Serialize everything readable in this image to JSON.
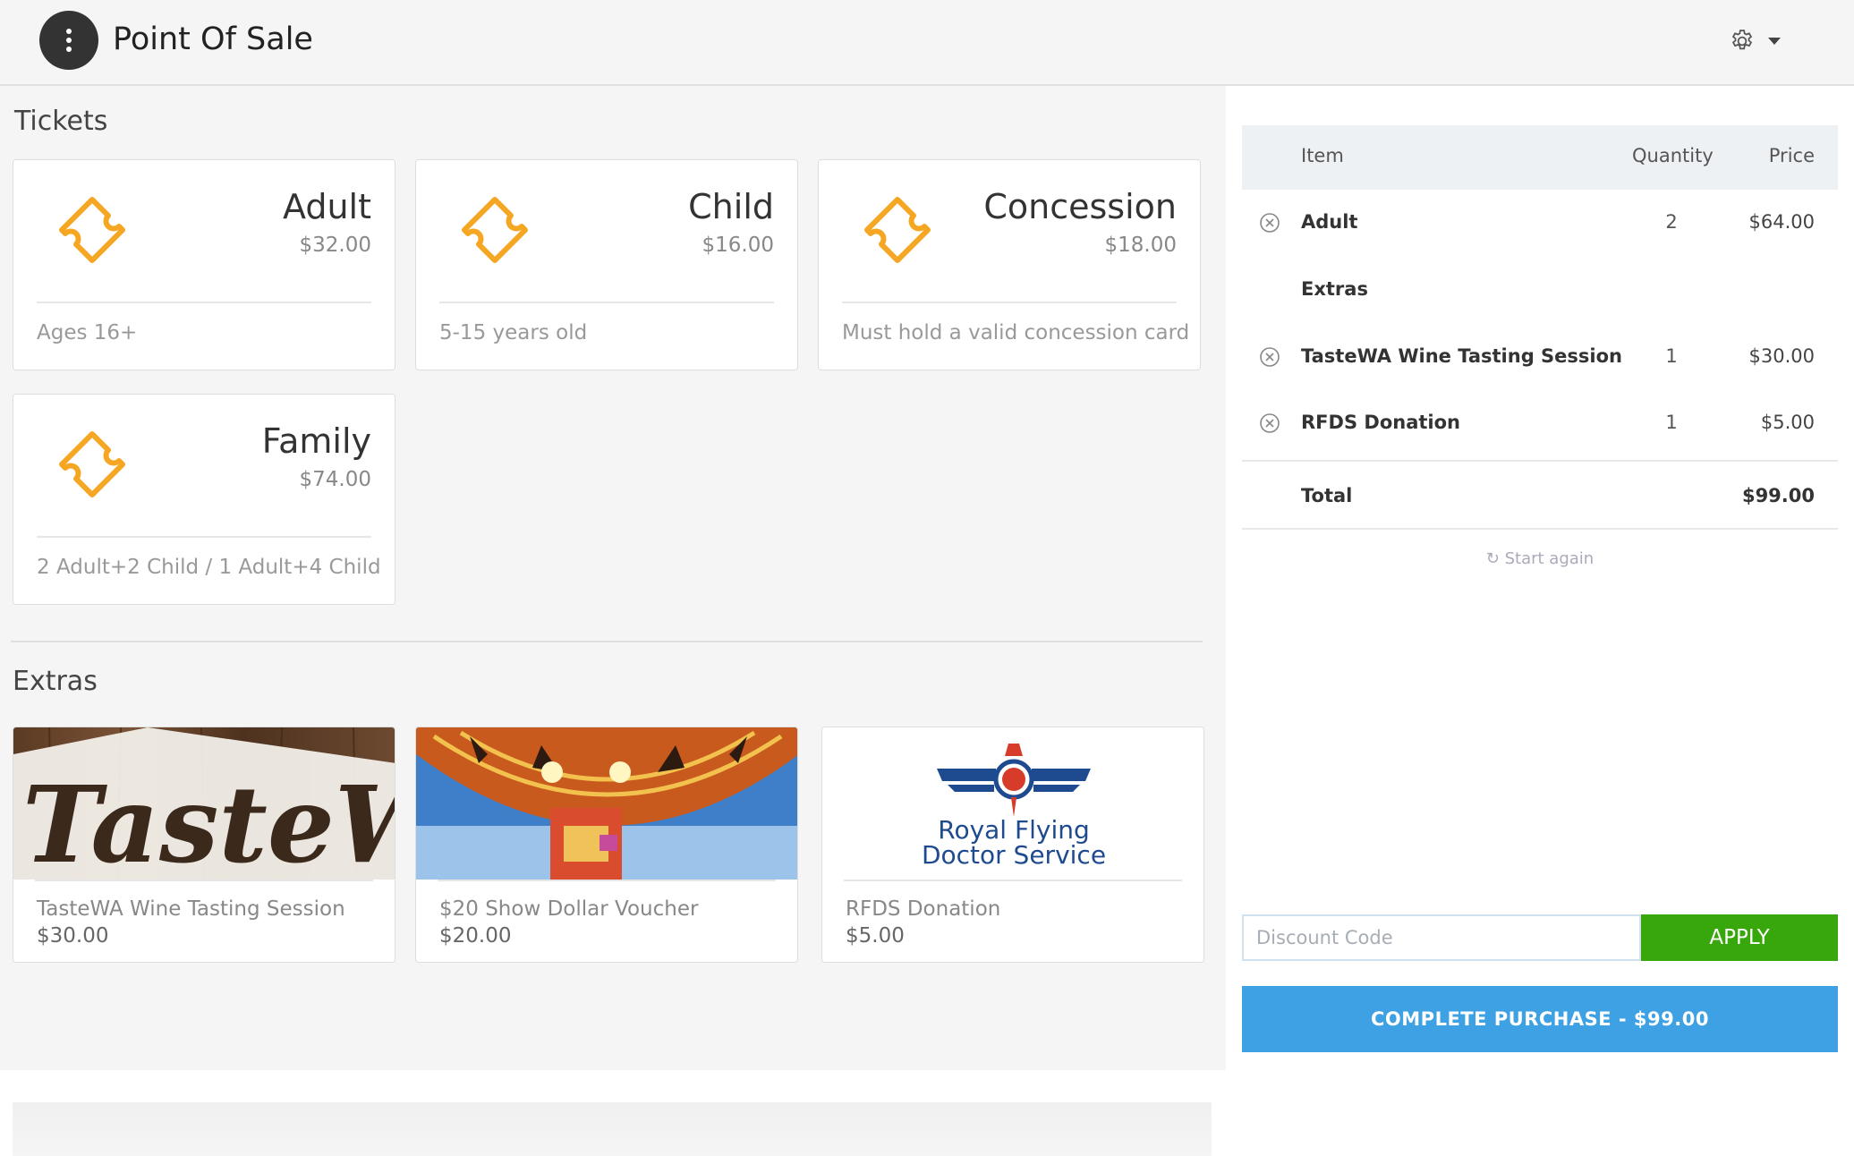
{
  "app": {
    "title": "Point Of Sale"
  },
  "sections": {
    "tickets": "Tickets",
    "extras": "Extras"
  },
  "tickets": [
    {
      "name": "Adult",
      "price": "$32.00",
      "desc": "Ages 16+"
    },
    {
      "name": "Child",
      "price": "$16.00",
      "desc": "5-15 years old"
    },
    {
      "name": "Concession",
      "price": "$18.00",
      "desc": "Must hold a valid concession card"
    },
    {
      "name": "Family",
      "price": "$74.00",
      "desc": "2 Adult+2 Child / 1 Adult+4 Child"
    }
  ],
  "extras": [
    {
      "name": "TasteWA Wine Tasting Session",
      "price": "$30.00",
      "image_text": "TasteWA"
    },
    {
      "name": "$20 Show Dollar Voucher",
      "price": "$20.00"
    },
    {
      "name": "RFDS Donation",
      "price": "$5.00",
      "image_text_1": "Royal Flying",
      "image_text_2": "Doctor Service"
    }
  ],
  "cart": {
    "headers": {
      "item": "Item",
      "quantity": "Quantity",
      "price": "Price"
    },
    "rows": [
      {
        "item": "Adult",
        "qty": "2",
        "price": "$64.00"
      },
      {
        "item": "Extras"
      },
      {
        "item": "TasteWA Wine Tasting Session",
        "qty": "1",
        "price": "$30.00"
      },
      {
        "item": "RFDS Donation",
        "qty": "1",
        "price": "$5.00"
      }
    ],
    "total_label": "Total",
    "total": "$99.00",
    "start_again": "Start again"
  },
  "discount": {
    "placeholder": "Discount Code",
    "apply": "APPLY"
  },
  "complete": "COMPLETE PURCHASE - $99.00",
  "colors": {
    "accent_orange": "#f5a623",
    "apply_green": "#38a70c",
    "complete_blue": "#3ea1e3"
  }
}
